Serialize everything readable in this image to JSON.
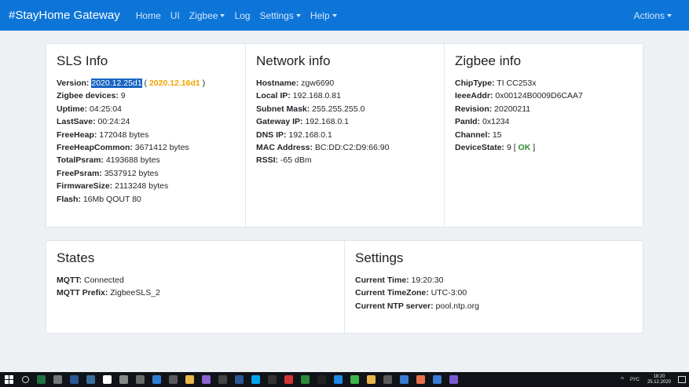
{
  "navbar": {
    "brand": "#StayHome Gateway",
    "items": [
      {
        "label": "Home",
        "dropdown": false
      },
      {
        "label": "UI",
        "dropdown": false
      },
      {
        "label": "Zigbee",
        "dropdown": true
      },
      {
        "label": "Log",
        "dropdown": false
      },
      {
        "label": "Settings",
        "dropdown": true
      },
      {
        "label": "Help",
        "dropdown": true
      }
    ],
    "actions": "Actions",
    "background_color": "#0d75d8"
  },
  "sls_info": {
    "title": "SLS Info",
    "version_label": "Version:",
    "version_value": "2020.12.25d1",
    "version_open": " ( ",
    "version_update": "2020.12.16d1",
    "version_close": " )",
    "rows": [
      {
        "label": "Zigbee devices:",
        "value": " 9"
      },
      {
        "label": "Uptime:",
        "value": " 04:25:04"
      },
      {
        "label": "LastSave:",
        "value": " 00:24:24"
      },
      {
        "label": "FreeHeap:",
        "value": " 172048 bytes"
      },
      {
        "label": "FreeHeapCommon:",
        "value": " 3671412 bytes"
      },
      {
        "label": "TotalPsram:",
        "value": " 4193688 bytes"
      },
      {
        "label": "FreePsram:",
        "value": " 3537912 bytes"
      },
      {
        "label": "FirmwareSize:",
        "value": " 2113248 bytes"
      },
      {
        "label": "Flash:",
        "value": " 16Mb QOUT 80"
      }
    ]
  },
  "network_info": {
    "title": "Network info",
    "rows": [
      {
        "label": "Hostname:",
        "value": " zgw6690"
      },
      {
        "label": "Local IP:",
        "value": " 192.168.0.81"
      },
      {
        "label": "Subnet Mask:",
        "value": " 255.255.255.0"
      },
      {
        "label": "Gateway IP:",
        "value": " 192.168.0.1"
      },
      {
        "label": "DNS IP:",
        "value": " 192.168.0.1"
      },
      {
        "label": "MAC Address:",
        "value": " BC:DD:C2:D9:66:90"
      },
      {
        "label": "RSSI:",
        "value": " -65 dBm"
      }
    ]
  },
  "zigbee_info": {
    "title": "Zigbee info",
    "rows": [
      {
        "label": "ChipType:",
        "value": " TI CC253x"
      },
      {
        "label": "IeeeAddr:",
        "value": " 0x00124B0009D6CAA7"
      },
      {
        "label": "Revision:",
        "value": " 20200211"
      },
      {
        "label": "PanId:",
        "value": " 0x1234"
      },
      {
        "label": "Channel:",
        "value": " 15"
      }
    ],
    "state_label": "DeviceState:",
    "state_value": " 9 [ ",
    "state_ok": "OK",
    "state_close": " ]"
  },
  "states": {
    "title": "States",
    "rows": [
      {
        "label": "MQTT:",
        "value": " Connected"
      },
      {
        "label": "MQTT Prefix:",
        "value": " ZigbeeSLS_2"
      }
    ]
  },
  "settings": {
    "title": "Settings",
    "rows": [
      {
        "label": "Current Time:",
        "value": " 19:20:30"
      },
      {
        "label": "Current TimeZone:",
        "value": " UTC-3:00"
      },
      {
        "label": "Current NTP server:",
        "value": " pool.ntp.org"
      }
    ]
  },
  "taskbar": {
    "apps": [
      {
        "icon": "search-icon",
        "color": "#101418"
      },
      {
        "icon": "excel-icon",
        "color": "#1e7145"
      },
      {
        "icon": "app-icon",
        "color": "#777777"
      },
      {
        "icon": "app-icon",
        "color": "#2b5797"
      },
      {
        "icon": "app-icon",
        "color": "#3c6e9e"
      },
      {
        "icon": "app-icon",
        "color": "#ffffff"
      },
      {
        "icon": "app-icon",
        "color": "#888888"
      },
      {
        "icon": "app-icon",
        "color": "#6a6a6a"
      },
      {
        "icon": "app-icon",
        "color": "#2d7dd2"
      },
      {
        "icon": "app-icon",
        "color": "#5a5a5a"
      },
      {
        "icon": "folder-icon",
        "color": "#e8b84a"
      },
      {
        "icon": "app-icon",
        "color": "#8a63d2"
      },
      {
        "icon": "app-icon",
        "color": "#444444"
      },
      {
        "icon": "app-icon",
        "color": "#2b5797"
      },
      {
        "icon": "skype-icon",
        "color": "#00a2ed"
      },
      {
        "icon": "app-icon",
        "color": "#333333"
      },
      {
        "icon": "app-icon",
        "color": "#d13438"
      },
      {
        "icon": "app-icon",
        "color": "#2d8a3a"
      },
      {
        "icon": "terminal-icon",
        "color": "#222222"
      },
      {
        "icon": "edge-icon",
        "color": "#1e88e5"
      },
      {
        "icon": "app-icon",
        "color": "#3cb54a"
      },
      {
        "icon": "chrome-icon",
        "color": "#e8b84a"
      },
      {
        "icon": "app-icon",
        "color": "#5a5a5a"
      },
      {
        "icon": "app-icon",
        "color": "#3a7bd5"
      },
      {
        "icon": "firefox-icon",
        "color": "#e8704a"
      },
      {
        "icon": "app-icon",
        "color": "#3a7bd5"
      },
      {
        "icon": "app-icon",
        "color": "#7a5ad2"
      }
    ],
    "lang": "РУС",
    "time": "18:20",
    "date": "25.12.2020"
  }
}
